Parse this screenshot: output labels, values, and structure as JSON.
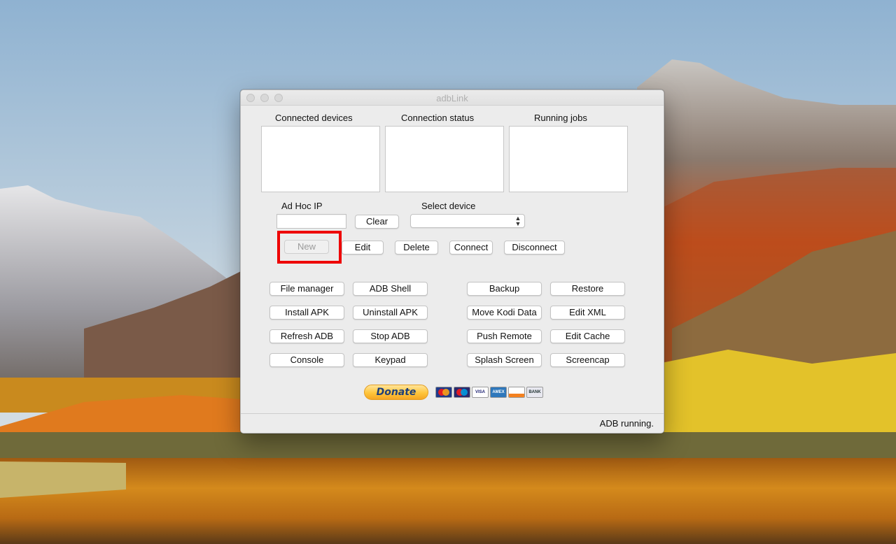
{
  "window": {
    "title": "adbLink",
    "status": "ADB running."
  },
  "panels": [
    {
      "label": "Connected devices"
    },
    {
      "label": "Connection status"
    },
    {
      "label": "Running jobs"
    }
  ],
  "adhoc": {
    "label": "Ad Hoc IP",
    "value": "",
    "clear": "Clear"
  },
  "device": {
    "label": "Select device",
    "selected": ""
  },
  "device_buttons": {
    "new": "New",
    "edit": "Edit",
    "delete": "Delete",
    "connect": "Connect",
    "disconnect": "Disconnect"
  },
  "actions": {
    "file_manager": "File manager",
    "adb_shell": "ADB Shell",
    "install_apk": "Install APK",
    "uninstall_apk": "Uninstall APK",
    "refresh_adb": "Refresh ADB",
    "stop_adb": "Stop ADB",
    "console": "Console",
    "keypad": "Keypad",
    "backup": "Backup",
    "restore": "Restore",
    "move_kodi_data": "Move Kodi Data",
    "edit_xml": "Edit XML",
    "push_remote": "Push Remote",
    "edit_cache": "Edit Cache",
    "splash_screen": "Splash Screen",
    "screencap": "Screencap"
  },
  "donate": {
    "label": "Donate",
    "cards": [
      "mastercard-icon",
      "maestro-icon",
      "visa-icon",
      "amex-icon",
      "discover-icon",
      "bank-icon"
    ]
  },
  "colors": {
    "highlight": "#ee0000",
    "donate": "#ffc53b"
  }
}
